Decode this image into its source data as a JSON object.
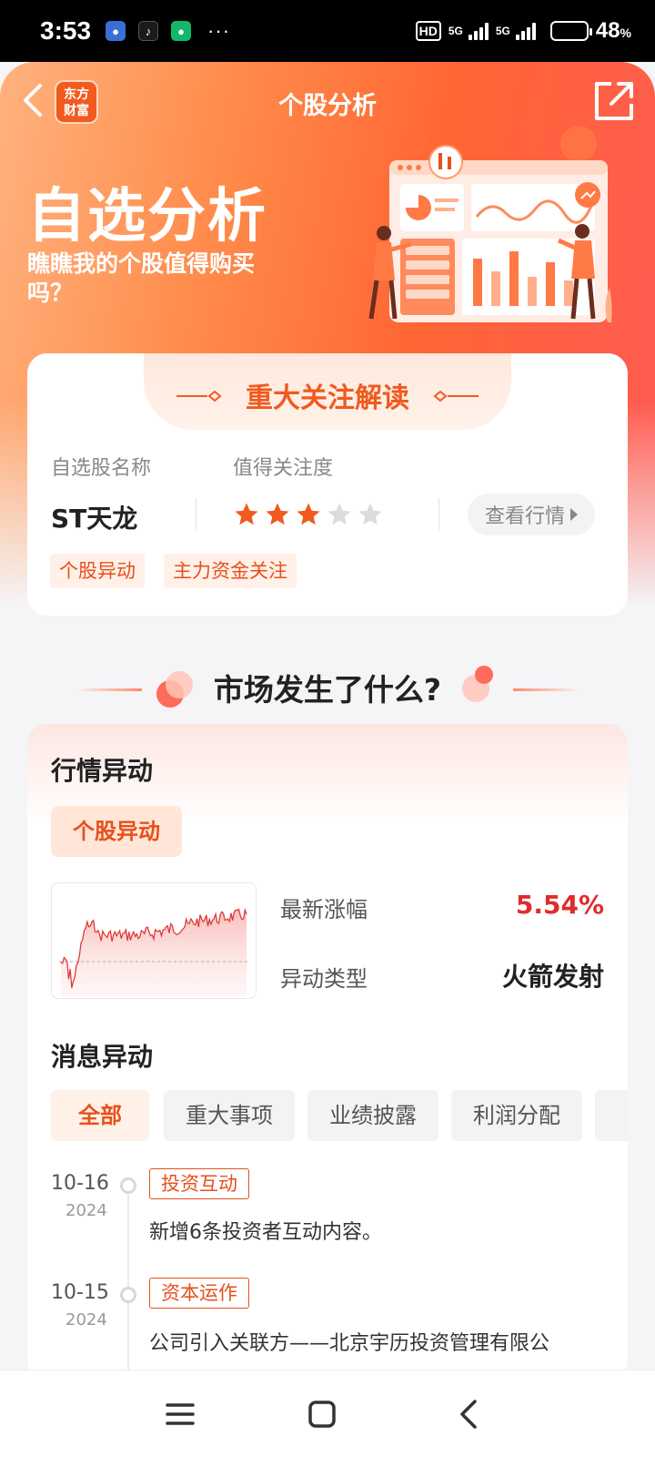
{
  "status_bar": {
    "time": "3:53",
    "apps": [
      "baidu-netdisk-icon",
      "tiktok-icon",
      "wechat-icon"
    ],
    "more": "···",
    "hd": "HD",
    "network": [
      "5G",
      "5G"
    ],
    "battery_level": 0.48,
    "battery_text": "48",
    "battery_unit": "%"
  },
  "header": {
    "logo_line1": "东方",
    "logo_line2": "财富",
    "title": "个股分析"
  },
  "hero": {
    "title": "自选分析",
    "subtitle": "瞧瞧我的个股值得购买吗？"
  },
  "attention": {
    "title": "重大关注解读",
    "name_label": "自选股名称",
    "score_label": "值得关注度",
    "stock_name": "ST天龙",
    "rating": 3,
    "rating_max": 5,
    "view_button": "查看行情",
    "tags": [
      "个股异动",
      "主力资金关注"
    ]
  },
  "market": {
    "section_title": "市场发生了什么?",
    "quote_heading": "行情异动",
    "quote_chip": "个股异动",
    "rise_label": "最新涨幅",
    "rise_value": "5.54%",
    "type_label": "异动类型",
    "type_value": "火箭发射",
    "news_heading": "消息异动",
    "filters": [
      "全部",
      "重大事项",
      "业绩披露",
      "利润分配"
    ],
    "timeline": [
      {
        "date": "10-16",
        "year": "2024",
        "tag": "投资互动",
        "text": "新增6条投资者互动内容。"
      },
      {
        "date": "10-15",
        "year": "2024",
        "tag": "资本运作",
        "text": "公司引入关联方——北京宇历投资管理有限公"
      }
    ]
  },
  "colors": {
    "accent": "#e8501c",
    "rise": "#e02b2b",
    "hero_start": "#ffb27e",
    "hero_end": "#ff5a55"
  }
}
